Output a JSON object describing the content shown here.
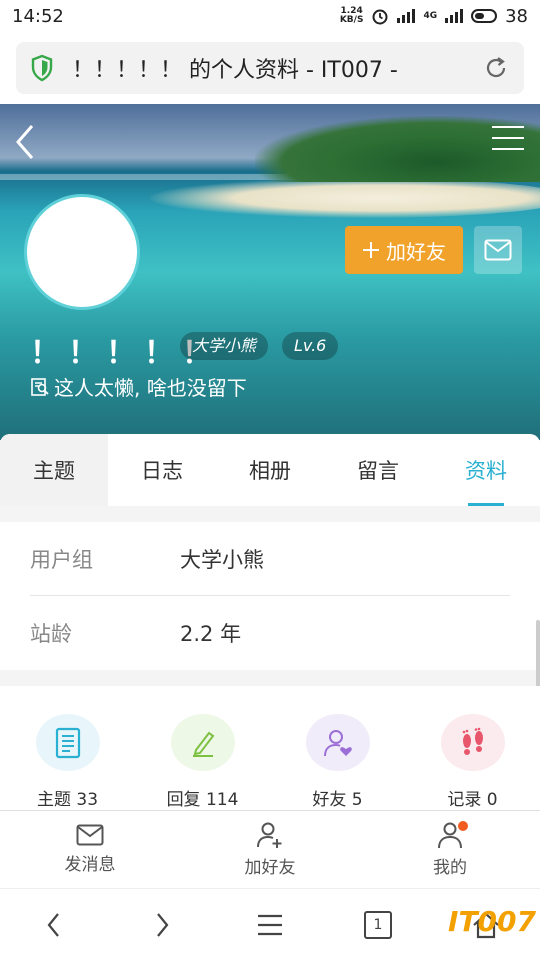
{
  "status_bar": {
    "time": "14:52",
    "speed_value": "1.24",
    "speed_unit": "KB/S",
    "network": "4G",
    "battery": "38"
  },
  "address_bar": {
    "title": "！！！！！ 的个人资料 - IT007 -"
  },
  "profile": {
    "username": "！！！！！",
    "group_tag": "大学小熊",
    "level_tag": "Lv.6",
    "signature": "这人太懒, 啥也没留下",
    "add_friend_label": "加好友"
  },
  "tabs": [
    {
      "label": "主题"
    },
    {
      "label": "日志"
    },
    {
      "label": "相册"
    },
    {
      "label": "留言"
    },
    {
      "label": "资料"
    }
  ],
  "info": [
    {
      "key": "用户组",
      "value": "大学小熊"
    },
    {
      "key": "站龄",
      "value": "2.2 年"
    }
  ],
  "stats": [
    {
      "label": "主题 33",
      "icon": "document-icon",
      "color": "#e8f6fb"
    },
    {
      "label": "回复 114",
      "icon": "pen-icon",
      "color": "#eef8e6"
    },
    {
      "label": "好友 5",
      "icon": "friend-heart-icon",
      "color": "#f1ecfa"
    },
    {
      "label": "记录 0",
      "icon": "footprints-icon",
      "color": "#fbeaee"
    }
  ],
  "actions": [
    {
      "label": "发消息"
    },
    {
      "label": "加好友"
    },
    {
      "label": "我的"
    }
  ],
  "browser": {
    "tab_count": "1"
  },
  "watermark": "IT007",
  "colors": {
    "accent": "#2ab0d0",
    "add_friend": "#f0a22a",
    "badge": "#f25c1e"
  }
}
